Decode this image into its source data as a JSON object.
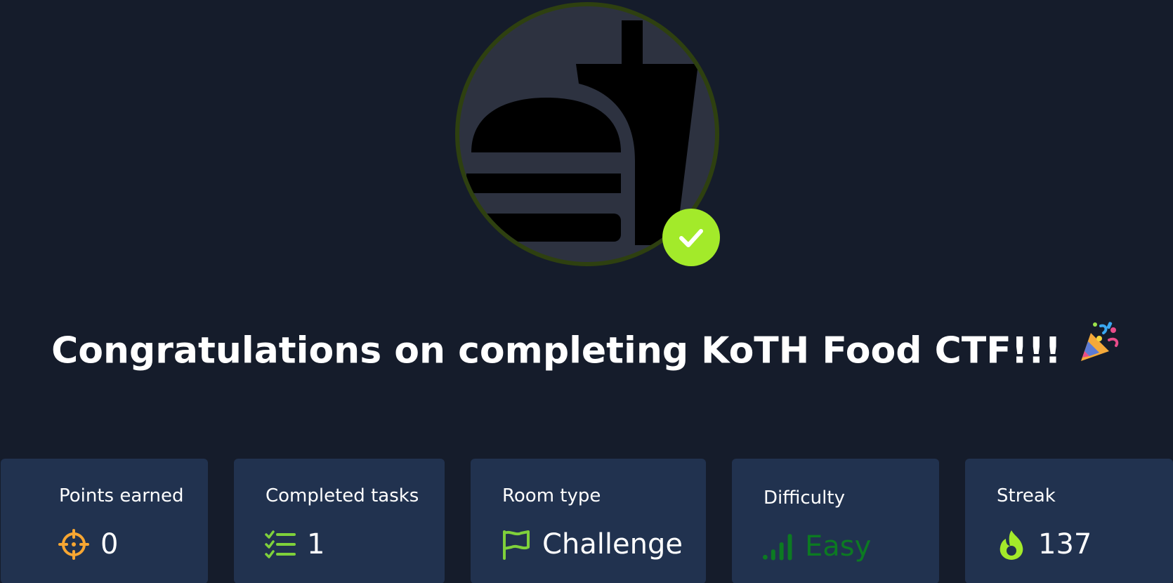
{
  "room": {
    "icon": "burger-drink-icon",
    "completed_icon": "check-icon"
  },
  "headline": {
    "text": "Congratulations on completing KoTH Food CTF!!!",
    "emoji_icon": "party-popper-icon"
  },
  "stats": {
    "points": {
      "label": "Points earned",
      "value": "0",
      "icon": "crosshair-icon"
    },
    "tasks": {
      "label": "Completed tasks",
      "value": "1",
      "icon": "checklist-icon"
    },
    "room_type": {
      "label": "Room type",
      "value": "Challenge",
      "icon": "flag-icon"
    },
    "difficulty": {
      "label": "Difficulty",
      "value": "Easy",
      "icon": "signal-bars-icon"
    },
    "streak": {
      "label": "Streak",
      "value": "137",
      "icon": "fire-icon"
    }
  },
  "colors": {
    "background": "#151c2b",
    "card": "#21324f",
    "accent_green": "#a3ea2a",
    "points_orange": "#f7a632",
    "easy_green": "#0c7a22"
  }
}
